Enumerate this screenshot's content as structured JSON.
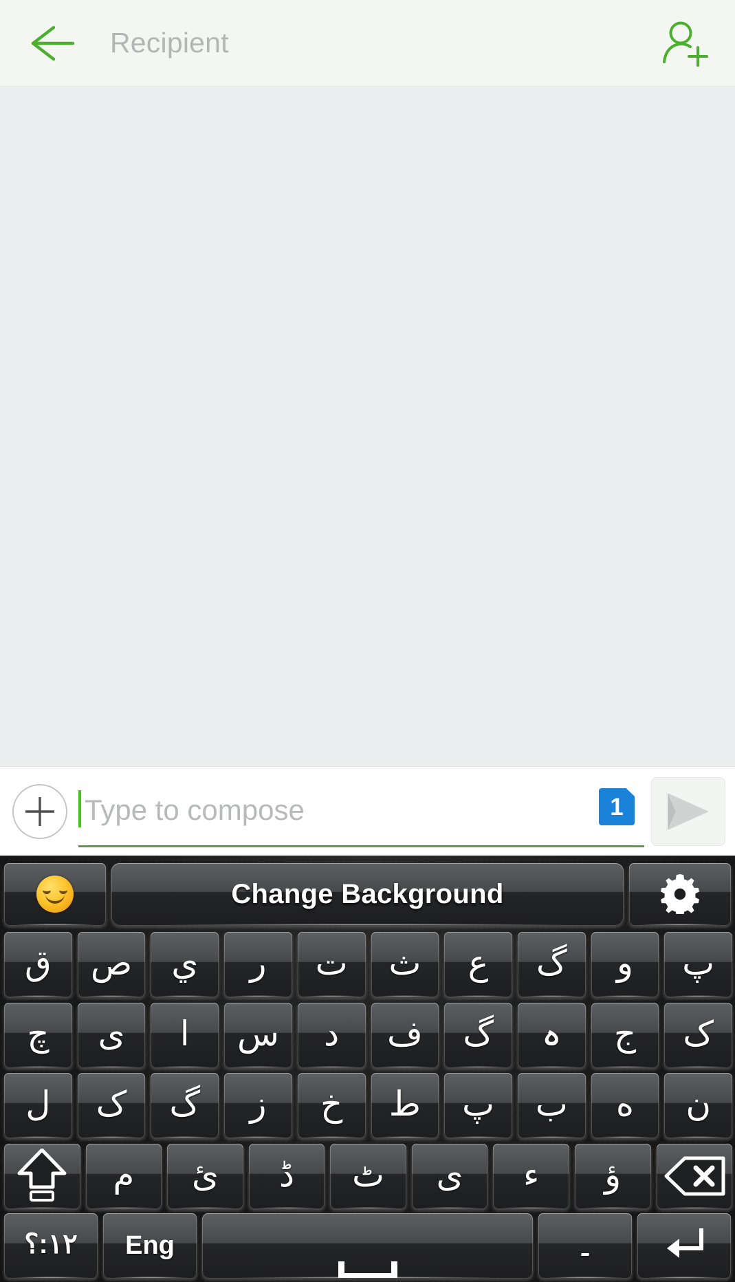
{
  "header": {
    "back_icon": "arrow-left-icon",
    "recipient_placeholder": "Recipient",
    "add_contact_icon": "add-person-icon",
    "accent_color": "#4caf2f",
    "background_color": "#f4f6f2"
  },
  "thread": {
    "background_color": "#ebedef",
    "messages": []
  },
  "compose": {
    "attach_icon": "plus-icon",
    "placeholder": "Type to compose",
    "value": "",
    "caret_color": "#47c11b",
    "underline_color": "#5b9a3f",
    "sim_badge_label": "1",
    "sim_badge_color": "#1a82d8",
    "send_icon": "send-plane-icon",
    "send_icon_color": "#c9cdcb"
  },
  "keyboard": {
    "language": "Urdu",
    "toolbar": {
      "emoji_icon": "smiley-icon",
      "change_background_label": "Change Background",
      "settings_icon": "gear-icon"
    },
    "rows": [
      {
        "name": "row-1",
        "keys": [
          {
            "label": "ق",
            "name": "key-qaf"
          },
          {
            "label": "ص",
            "name": "key-suad"
          },
          {
            "label": "ي",
            "name": "key-yeh-arabic"
          },
          {
            "label": "ر",
            "name": "key-reh"
          },
          {
            "label": "ت",
            "name": "key-teh"
          },
          {
            "label": "ث",
            "name": "key-theh"
          },
          {
            "label": "ع",
            "name": "key-ain"
          },
          {
            "label": "گ",
            "name": "key-gaf"
          },
          {
            "label": "و",
            "name": "key-waw"
          },
          {
            "label": "پ",
            "name": "key-peh"
          }
        ]
      },
      {
        "name": "row-2",
        "keys": [
          {
            "label": "چ",
            "name": "key-cheh"
          },
          {
            "label": "ی",
            "name": "key-farsi-yeh"
          },
          {
            "label": "ا",
            "name": "key-alef"
          },
          {
            "label": "س",
            "name": "key-seen"
          },
          {
            "label": "د",
            "name": "key-dal"
          },
          {
            "label": "ف",
            "name": "key-feh"
          },
          {
            "label": "گ",
            "name": "key-gaf-2"
          },
          {
            "label": "ہ",
            "name": "key-heh-goal"
          },
          {
            "label": "ج",
            "name": "key-jeem"
          },
          {
            "label": "ک",
            "name": "key-keheh"
          }
        ]
      },
      {
        "name": "row-3",
        "keys": [
          {
            "label": "ل",
            "name": "key-lam"
          },
          {
            "label": "ک",
            "name": "key-keheh-2"
          },
          {
            "label": "گ",
            "name": "key-gaf-3"
          },
          {
            "label": "ز",
            "name": "key-zain"
          },
          {
            "label": "خ",
            "name": "key-khah"
          },
          {
            "label": "ط",
            "name": "key-tah"
          },
          {
            "label": "پ",
            "name": "key-peh-2"
          },
          {
            "label": "ب",
            "name": "key-beh"
          },
          {
            "label": "ه",
            "name": "key-heh"
          },
          {
            "label": "ن",
            "name": "key-noon"
          }
        ]
      },
      {
        "name": "row-4",
        "keys": [
          {
            "label": "",
            "name": "key-shift",
            "icon": "shift-arrow-icon"
          },
          {
            "label": "م",
            "name": "key-meem"
          },
          {
            "label": "ئ",
            "name": "key-yeh-hamza"
          },
          {
            "label": "ڈ",
            "name": "key-ddal"
          },
          {
            "label": "ٹ",
            "name": "key-tteh"
          },
          {
            "label": "ی",
            "name": "key-farsi-yeh-2"
          },
          {
            "label": "ء",
            "name": "key-hamza"
          },
          {
            "label": "ؤ",
            "name": "key-waw-hamza"
          },
          {
            "label": "",
            "name": "key-backspace",
            "icon": "backspace-icon"
          }
        ]
      },
      {
        "name": "row-5",
        "keys": [
          {
            "label": "١٢:؟",
            "name": "key-symbols"
          },
          {
            "label": "Eng",
            "name": "key-language-eng"
          },
          {
            "label": "",
            "name": "key-space",
            "icon": "space-bar-icon"
          },
          {
            "label": "۔",
            "name": "key-urdu-full-stop"
          },
          {
            "label": "",
            "name": "key-enter",
            "icon": "enter-arrow-icon"
          }
        ]
      }
    ]
  }
}
